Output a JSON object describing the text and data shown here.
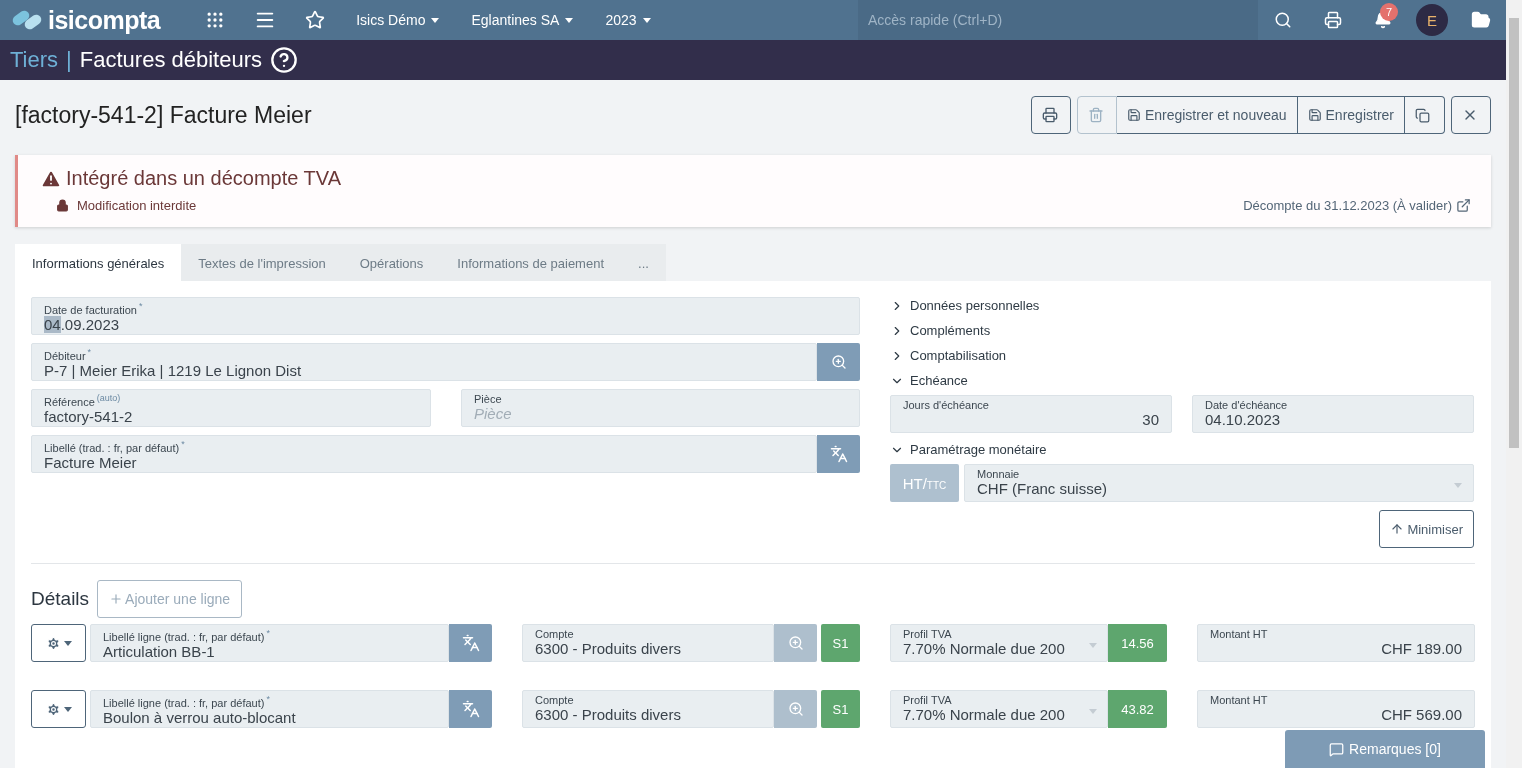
{
  "nav": {
    "logo": "isicompta",
    "menus": [
      {
        "label": "Isics Démo"
      },
      {
        "label": "Eglantines SA"
      },
      {
        "label": "2023"
      }
    ],
    "search": {
      "placeholder": "Accès rapide (Ctrl+D)"
    },
    "notifications": "7",
    "avatar": "E"
  },
  "breadcrumb": {
    "parent": "Tiers",
    "separator": "|",
    "title": "Factures débiteurs"
  },
  "record": {
    "title": "[factory-541-2] Facture Meier"
  },
  "toolbar": [
    {
      "kind": "print",
      "disabled": false
    },
    {
      "kind": "delete",
      "disabled": true
    },
    {
      "kind": "save",
      "label": "Enregistrer et nouveau",
      "disabled": false
    },
    {
      "kind": "save",
      "label": "Enregistrer",
      "disabled": false
    },
    {
      "kind": "copy",
      "disabled": false
    },
    {
      "kind": "close",
      "disabled": false
    }
  ],
  "alert": {
    "title": "Intégré dans un décompte TVA",
    "lock": "Modification interdite",
    "link": "Décompte du 31.12.2023 (À valider)"
  },
  "tabs": [
    {
      "label": "Informations générales",
      "selected": true
    },
    {
      "label": "Textes de l'impression",
      "selected": false
    },
    {
      "label": "Opérations",
      "selected": false
    },
    {
      "label": "Informations de paiement",
      "selected": false
    },
    {
      "label": "...",
      "selected": false
    }
  ],
  "form": {
    "date": {
      "label": "Date de facturation",
      "mark": "*",
      "value_selected": "04",
      "value_rest": ".09.2023"
    },
    "debtor": {
      "label": "Débiteur",
      "mark": "*",
      "value": "P-7 | Meier Erika | 1219 Le Lignon Dist"
    },
    "reference": {
      "label": "Référence",
      "tag": "(auto)",
      "value": "factory-541-2"
    },
    "piece": {
      "label": "Pièce",
      "placeholder": "Pièce"
    },
    "libelle": {
      "label": "Libellé (trad. : fr, par défaut)",
      "mark": "*",
      "value": "Facture Meier"
    }
  },
  "sections": [
    {
      "label": "Données personnelles",
      "expanded": false
    },
    {
      "label": "Compléments",
      "expanded": false
    },
    {
      "label": "Comptabilisation",
      "expanded": false
    },
    {
      "label": "Echéance",
      "expanded": true,
      "fields": [
        {
          "label": "Jours d'échéance",
          "value": "30",
          "kind": "number"
        },
        {
          "label": "Date d'échéance",
          "value": "04.10.2023",
          "kind": "date"
        }
      ]
    },
    {
      "label": "Paramétrage monétaire",
      "expanded": true,
      "toggle": {
        "main": "HT/",
        "sub": "TTC"
      },
      "currency": {
        "label": "Monnaie",
        "value": "CHF (Franc suisse)"
      }
    }
  ],
  "minimize": "Minimiser",
  "details": {
    "title": "Détails",
    "add": "Ajouter une ligne",
    "lines": [
      {
        "label_field": "Libellé ligne (trad. : fr, par défaut)",
        "mark": "*",
        "label": "Articulation BB-1",
        "account_field": "Compte",
        "account": "6300 - Produits divers",
        "code": "S1",
        "vat_field": "Profil TVA",
        "vat": "7.70% Normale due 200",
        "vat_amount": "14.56",
        "amount_field": "Montant HT",
        "amount": "CHF 189.00"
      },
      {
        "label_field": "Libellé ligne (trad. : fr, par défaut)",
        "mark": "*",
        "label": "Boulon à verrou auto-blocant",
        "account_field": "Compte",
        "account": "6300 - Produits divers",
        "code": "S1",
        "vat_field": "Profil TVA",
        "vat": "7.70% Normale due 200",
        "vat_amount": "43.82",
        "amount_field": "Montant HT",
        "amount": "CHF 569.00"
      }
    ]
  },
  "remarks": "Remarques [0]"
}
